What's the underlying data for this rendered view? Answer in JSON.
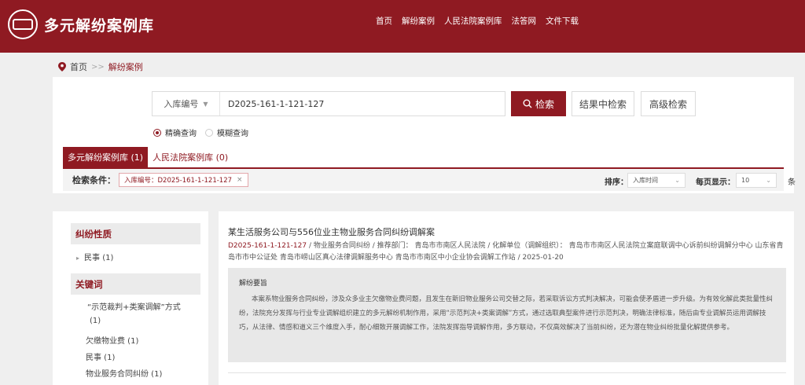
{
  "header": {
    "site_title": "多元解纷案例库",
    "logo_text": "多元解纷",
    "nav": [
      "首页",
      "解纷案例",
      "人民法院案例库",
      "法答网",
      "文件下载"
    ]
  },
  "breadcrumb": {
    "home": "首页",
    "separator": ">>",
    "current": "解纷案例"
  },
  "search": {
    "field_label": "入库编号",
    "query": "D2025-161-1-121-127",
    "search_button": "检索",
    "refine_button": "结果中检索",
    "advanced_button": "高级检索",
    "modes": [
      "精确查询",
      "模糊查询"
    ],
    "selected_mode": "精确查询"
  },
  "tabs": [
    {
      "label": "多元解纷案例库 (1)",
      "active": true
    },
    {
      "label": "人民法院案例库 (0)",
      "active": false
    }
  ],
  "filter": {
    "label": "检索条件：",
    "tag": "入库编号：D2025-161-1-121-127",
    "sort_label": "排序：",
    "sort_value": "入库时间",
    "per_page_label": "每页显示：",
    "per_page_value": "10",
    "per_page_unit": "条"
  },
  "sidebar": {
    "groups": [
      {
        "title": "纠纷性质",
        "items": [
          "民事  (1)"
        ]
      },
      {
        "title": "关键词",
        "items": [
          "“示范裁判+类案调解”方式",
          "(1)",
          "欠缴物业费  (1)",
          "民事  (1)",
          "物业服务合同纠纷  (1)"
        ]
      }
    ]
  },
  "results": [
    {
      "title": "某生活服务公司与556位业主物业服务合同纠纷调解案",
      "id": "D2025-161-1-121-127",
      "meta": " / 物业服务合同纠纷 / 推荐部门：  青岛市市南区人民法院   / 化解单位（调解组织）：  青岛市市南区人民法院立案庭联调中心诉前纠纷调解分中心  山东省青岛市市中公证处  青岛市崂山区真心法律调解服务中心  青岛市市南区中小企业协会调解工作站   / 2025-01-20",
      "summary_heading": "解纷要旨",
      "summary": "本案系物业服务合同纠纷，涉及众多业主欠缴物业费问题，且发生在新旧物业服务公司交替之际，若采取诉讼方式判决解决，可能会使矛盾进一步升级。为有效化解此类批量性纠纷，法院充分发挥与行业专业调解组织建立的多元解纷机制作用，采用“示范判决+类案调解”方式，通过选取典型案件进行示范判决，明确法律标准，随后由专业调解员运用调解技巧，从法律、情感和道义三个维度入手，耐心细致开展调解工作，法院发挥指导调解作用，多方联动，不仅高效解决了当前纠纷，还为潜在物业纠纷批量化解提供参考。"
    }
  ],
  "colors": {
    "brand": "#8f1a22",
    "page_bg": "#efefef"
  }
}
